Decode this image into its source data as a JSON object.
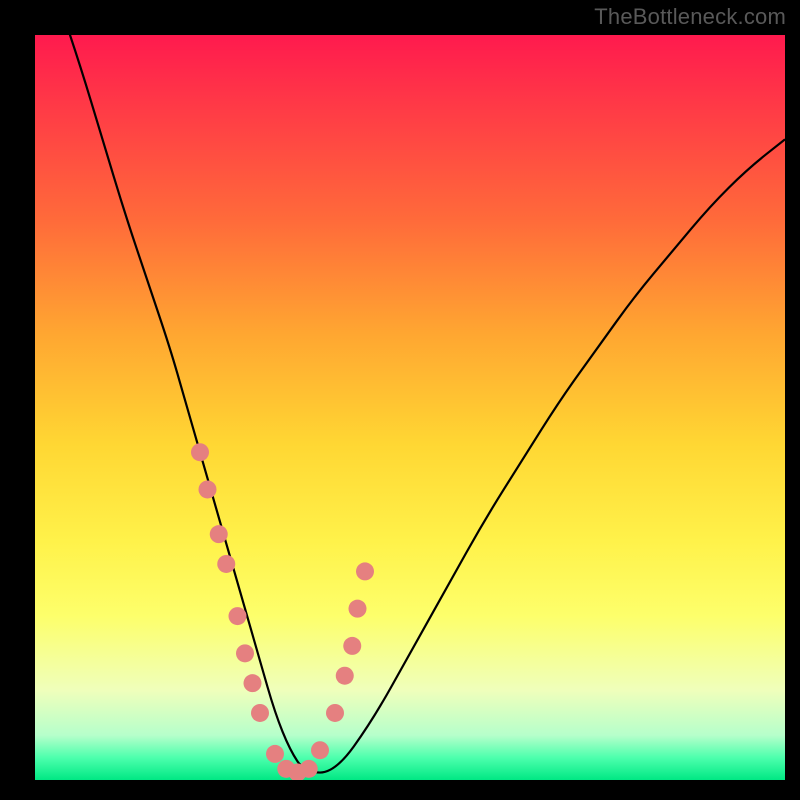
{
  "watermark": "TheBottleneck.com",
  "chart_data": {
    "type": "line",
    "title": "",
    "xlabel": "",
    "ylabel": "",
    "xlim": [
      0,
      100
    ],
    "ylim": [
      0,
      100
    ],
    "series": [
      {
        "name": "bottleneck-curve",
        "x": [
          3,
          6,
          9,
          12,
          15,
          18,
          20,
          22,
          24,
          26,
          28,
          30,
          32,
          34,
          36,
          40,
          45,
          50,
          55,
          60,
          65,
          70,
          75,
          80,
          85,
          90,
          95,
          100
        ],
        "values": [
          105,
          96,
          86,
          76,
          67,
          58,
          51,
          44,
          37,
          30,
          23,
          16,
          9,
          4,
          1,
          1,
          8,
          17,
          26,
          35,
          43,
          51,
          58,
          65,
          71,
          77,
          82,
          86
        ]
      },
      {
        "name": "highlight-markers",
        "x": [
          22.0,
          23.0,
          24.5,
          25.5,
          27.0,
          28.0,
          29.0,
          30.0,
          32.0,
          33.5,
          35.0,
          36.5,
          38.0,
          40.0,
          41.3,
          42.3,
          43.0,
          44.0
        ],
        "values": [
          44.0,
          39.0,
          33.0,
          29.0,
          22.0,
          17.0,
          13.0,
          9.0,
          3.5,
          1.5,
          1.0,
          1.5,
          4.0,
          9.0,
          14.0,
          18.0,
          23.0,
          28.0
        ]
      }
    ],
    "gradient_stops": [
      {
        "pos": 0.0,
        "color": "#ff1a4e"
      },
      {
        "pos": 0.1,
        "color": "#ff3b46"
      },
      {
        "pos": 0.25,
        "color": "#ff6b3a"
      },
      {
        "pos": 0.4,
        "color": "#ffa631"
      },
      {
        "pos": 0.55,
        "color": "#ffd733"
      },
      {
        "pos": 0.68,
        "color": "#fff24a"
      },
      {
        "pos": 0.78,
        "color": "#fdff6b"
      },
      {
        "pos": 0.88,
        "color": "#efffbb"
      },
      {
        "pos": 0.94,
        "color": "#b6ffcb"
      },
      {
        "pos": 0.97,
        "color": "#4dffad"
      },
      {
        "pos": 1.0,
        "color": "#00e884"
      }
    ],
    "marker_color": "#e58080",
    "curve_color": "#000000"
  }
}
